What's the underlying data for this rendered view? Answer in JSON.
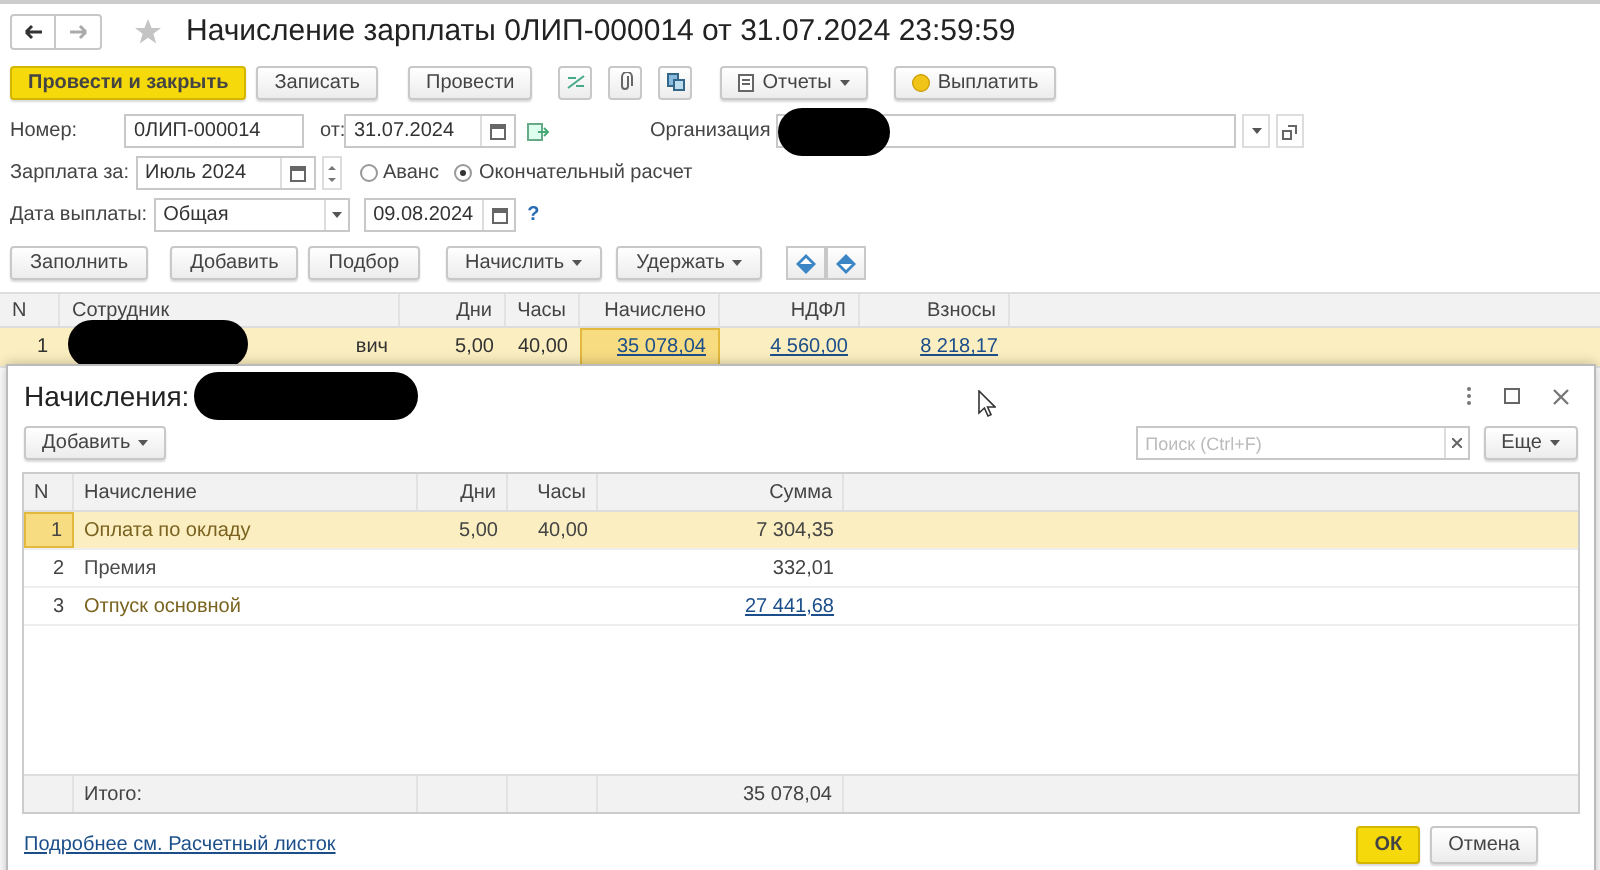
{
  "window": {
    "title": "Начисление зарплаты 0ЛИП-000014 от 31.07.2024 23:59:59",
    "favorite": false
  },
  "command_bar": {
    "buttons": [
      {
        "kind": "primary",
        "label": "Провести и закрыть"
      },
      {
        "kind": "plain",
        "label": "Записать"
      },
      {
        "kind": "plain",
        "label": "Провести"
      }
    ],
    "reports": {
      "label": "Отчеты"
    },
    "pay": {
      "label": "Выплатить"
    }
  },
  "header": {
    "number": {
      "label": "Номер:",
      "value": "0ЛИП-000014"
    },
    "date": {
      "label": "от:",
      "value": "31.07.2024"
    },
    "organization": {
      "label": "Организация"
    },
    "salary_for": {
      "label": "Зарплата за:",
      "value": "Июль 2024"
    },
    "payment_type": [
      {
        "label": "Аванс",
        "selected": false
      },
      {
        "label": "Окончательный расчет",
        "selected": true
      }
    ],
    "pay_date": {
      "label": "Дата выплаты:",
      "value": "Общая",
      "date": "09.08.2024",
      "help": "?"
    }
  },
  "table_buttons": [
    {
      "label": "Заполнить",
      "dropdown": false
    },
    {
      "label": "Добавить",
      "dropdown": false
    },
    {
      "label": "Подбор",
      "dropdown": false
    },
    {
      "label": "Начислить",
      "dropdown": true
    },
    {
      "label": "Удержать",
      "dropdown": true
    }
  ],
  "table": {
    "columns": [
      "N",
      "Сотрудник",
      "Дни",
      "Часы",
      "Начислено",
      "НДФЛ",
      "Взносы"
    ],
    "rows": [
      {
        "n": "1",
        "employee": "вич",
        "days": "5,00",
        "hours": "40,00",
        "accrued": "35 078,04",
        "ndfl": "4 560,00",
        "contributions": "8 218,17",
        "selected": true,
        "accrued_focused": true
      }
    ]
  },
  "dialog": {
    "title": "Начисления:",
    "add_button": {
      "label": "Добавить"
    },
    "search": {
      "placeholder": "Поиск (Ctrl+F)"
    },
    "more_button": {
      "label": "Еще"
    },
    "columns": [
      "N",
      "Начисление",
      "Дни",
      "Часы",
      "Сумма"
    ],
    "rows": [
      {
        "n": "1",
        "name": "Оплата по окладу",
        "days": "5,00",
        "hours": "40,00",
        "sum": "7 304,35",
        "sum_link": false,
        "selected": true,
        "color": "#7a6320"
      },
      {
        "n": "2",
        "name": "Премия",
        "sum": "332,01",
        "sum_link": false,
        "selected": false,
        "color": "#4a4a4a"
      },
      {
        "n": "3",
        "name": "Отпуск основной",
        "sum": "27 441,68",
        "sum_link": true,
        "selected": false,
        "color": "#7a6320"
      }
    ],
    "total": {
      "label": "Итого:",
      "sum": "35 078,04"
    },
    "details_link": "Подробнее см. Расчетный листок",
    "ok": "ОК",
    "cancel": "Отмена"
  }
}
